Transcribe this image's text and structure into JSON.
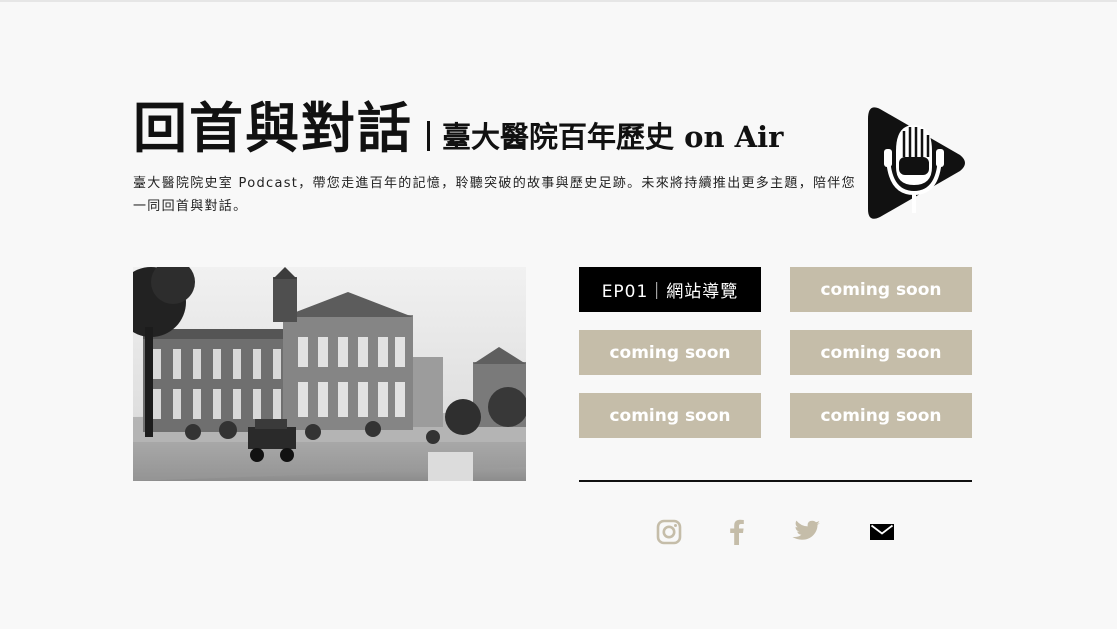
{
  "header": {
    "title": "回首與對話",
    "subtitle": "臺大醫院百年歷史 on Air",
    "description": "臺大醫院院史室 Podcast，帶您走進百年的記憶，聆聽突破的故事與歷史足跡。未來將持續推出更多主題，陪伴您一同回首與對話。"
  },
  "episodes": [
    {
      "label": "EP01｜網站導覽",
      "active": true
    },
    {
      "label": "coming soon",
      "active": false
    },
    {
      "label": "coming soon",
      "active": false
    },
    {
      "label": "coming soon",
      "active": false
    },
    {
      "label": "coming soon",
      "active": false
    },
    {
      "label": "coming soon",
      "active": false
    }
  ],
  "social": [
    {
      "icon": "instagram-icon"
    },
    {
      "icon": "facebook-icon"
    },
    {
      "icon": "twitter-icon"
    },
    {
      "icon": "email-icon"
    }
  ],
  "colors": {
    "background": "#f8f8f8",
    "accent_beige": "#c5bda9",
    "active_button": "#000000",
    "text": "#111111"
  }
}
